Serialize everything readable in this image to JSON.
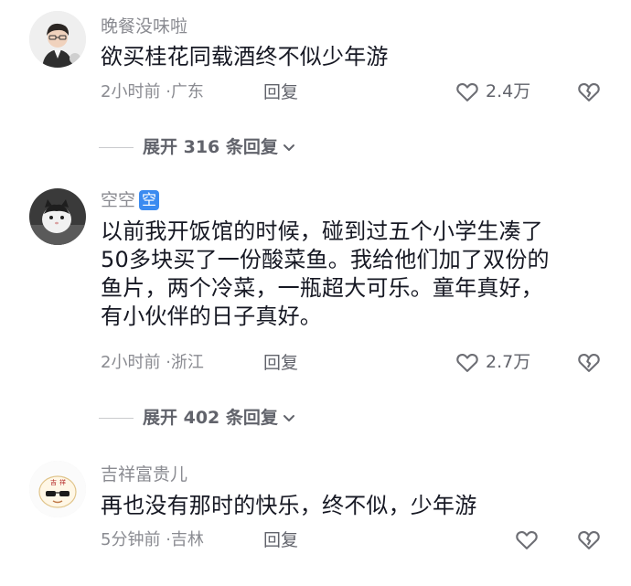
{
  "comments": [
    {
      "username": "晚餐没味啦",
      "text": "欲买桂花同载酒终不似少年游",
      "time": "2小时前",
      "location": "广东",
      "reply_label": "回复",
      "likes": "2.4万"
    },
    {
      "username": "空空",
      "badge": "空",
      "text": "以前我开饭馆的时候，碰到过五个小学生凑了\n50多块买了一份酸菜鱼。我给他们加了双份的\n鱼片，两个冷菜，一瓶超大可乐。童年真好，\n有小伙伴的日子真好。",
      "time": "2小时前",
      "location": "浙江",
      "reply_label": "回复",
      "likes": "2.7万"
    },
    {
      "username": "吉祥富贵儿",
      "text": "再也没有那时的快乐，终不似，少年游",
      "time": "5分钟前",
      "location": "吉林",
      "reply_label": "回复",
      "likes": ""
    }
  ],
  "expand": [
    {
      "label": "展开 316 条回复"
    },
    {
      "label": "展开 402 条回复"
    }
  ],
  "separator": "·",
  "icons": {
    "like": "heart-outline-icon",
    "dislike": "broken-heart-icon",
    "expand": "chevron-down-icon"
  },
  "colors": {
    "username": "#8a8b91",
    "badge": "#3b8bf0",
    "text": "#161823"
  }
}
